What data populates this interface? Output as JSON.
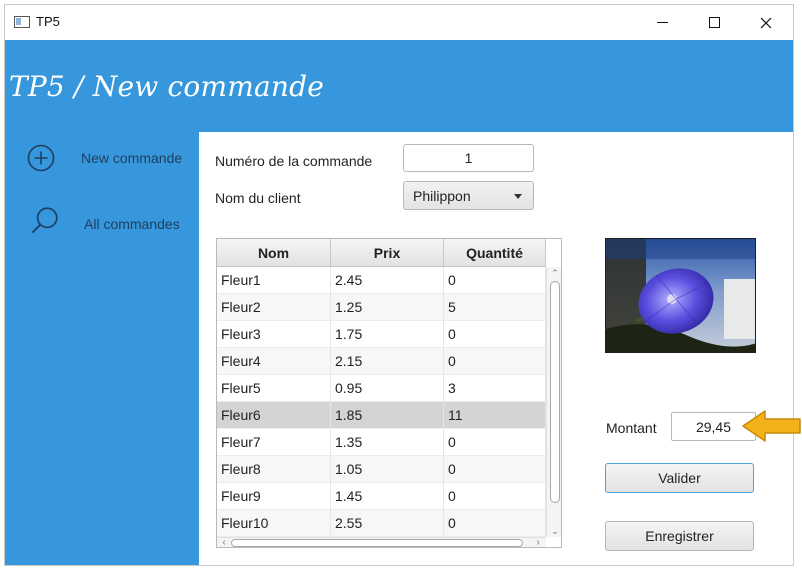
{
  "window": {
    "title": "TP5"
  },
  "header": {
    "title": "TP5 / New commande"
  },
  "sidebar": {
    "items": [
      {
        "label": "New commande",
        "icon": "plus-circle-icon"
      },
      {
        "label": "All commandes",
        "icon": "search-icon"
      }
    ]
  },
  "form": {
    "numero_label": "Numéro de la commande",
    "numero_value": "1",
    "client_label": "Nom du client",
    "client_value": "Philippon"
  },
  "table": {
    "columns": [
      "Nom",
      "Prix",
      "Quantité"
    ],
    "rows": [
      [
        "Fleur1",
        "2.45",
        "0"
      ],
      [
        "Fleur2",
        "1.25",
        "5"
      ],
      [
        "Fleur3",
        "1.75",
        "0"
      ],
      [
        "Fleur4",
        "2.15",
        "0"
      ],
      [
        "Fleur5",
        "0.95",
        "3"
      ],
      [
        "Fleur6",
        "1.85",
        "11"
      ],
      [
        "Fleur7",
        "1.35",
        "0"
      ],
      [
        "Fleur8",
        "1.05",
        "0"
      ],
      [
        "Fleur9",
        "1.45",
        "0"
      ],
      [
        "Fleur10",
        "2.55",
        "0"
      ]
    ],
    "selected_row": 5
  },
  "montant": {
    "label": "Montant",
    "value": "29,45"
  },
  "buttons": {
    "valider": "Valider",
    "enregistrer": "Enregistrer"
  },
  "colors": {
    "accent": "#3797dc",
    "arrow": "#f2b318"
  }
}
